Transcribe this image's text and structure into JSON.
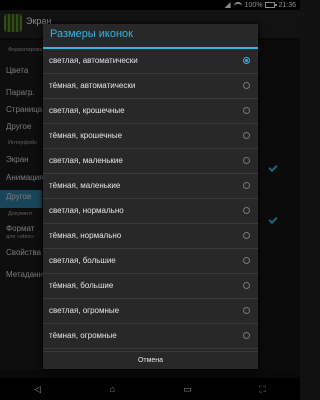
{
  "status": {
    "battery": "100%",
    "time": "21:36"
  },
  "app": {
    "title": "Экран"
  },
  "background_left": {
    "headers": [
      "Форматирова",
      "Интерфейс",
      "Документ"
    ],
    "items": [
      "Цвета",
      "Парагр.",
      "Страница",
      "Другое",
      "Экран",
      "Анимация",
      "Другое",
      "Формат",
      "Свойства",
      "Метаданн"
    ],
    "format_sub": "для «ebre»"
  },
  "dialog": {
    "title": "Размеры иконок",
    "options": [
      {
        "label": "светлая, автоматически",
        "selected": true
      },
      {
        "label": "тёмная, автоматически",
        "selected": false
      },
      {
        "label": "светлая, крошечные",
        "selected": false
      },
      {
        "label": "тёмная, крошечные",
        "selected": false
      },
      {
        "label": "светлая, маленькие",
        "selected": false
      },
      {
        "label": "тёмная, маленькие",
        "selected": false
      },
      {
        "label": "светлая, нормально",
        "selected": false
      },
      {
        "label": "тёмная, нормально",
        "selected": false
      },
      {
        "label": "светлая, большие",
        "selected": false
      },
      {
        "label": "тёмная, большие",
        "selected": false
      },
      {
        "label": "светлая, огромные",
        "selected": false
      },
      {
        "label": "тёмная, огромные",
        "selected": false
      }
    ],
    "cancel_label": "Отмена"
  },
  "nav": {
    "back_icon": "back-icon",
    "home_icon": "home-icon",
    "recents_icon": "recents-icon",
    "screenshot_icon": "screenshot-icon"
  },
  "colors": {
    "accent": "#33b5e5",
    "selected_bg": "#2d7fa3"
  }
}
